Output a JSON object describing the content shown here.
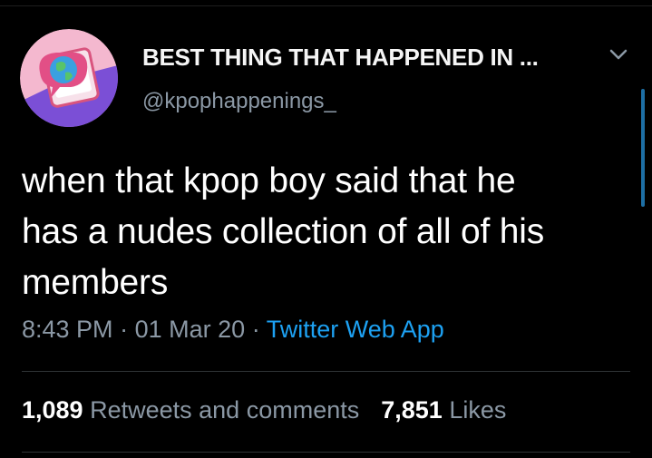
{
  "tweet": {
    "display_name": "BEST THING THAT HAPPENED IN ...",
    "handle": "@kpophappenings_",
    "text_lines": [
      "when that kpop boy said that he",
      "has a nudes collection of all of his",
      "members"
    ],
    "time": "8:43 PM",
    "separator": "·",
    "date": "01 Mar 20",
    "source": "Twitter Web App",
    "retweets_count": "1,089",
    "retweets_label": "Retweets and comments",
    "likes_count": "7,851",
    "likes_label": "Likes"
  },
  "icons": {
    "avatar": "globe-in-phone-speech-bubble-avatar",
    "menu": "chevron-down-icon"
  },
  "colors": {
    "background": "#000000",
    "text": "#ffffff",
    "secondary_text": "#8b98a5",
    "link": "#1da1f2",
    "divider": "#2f3336",
    "avatar_bg": "#f4b8cf",
    "avatar_accent": "#7b4fd6"
  }
}
